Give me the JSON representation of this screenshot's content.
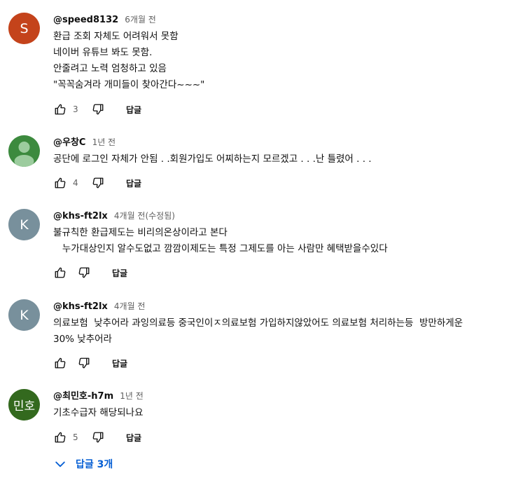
{
  "comments": [
    {
      "author": "@speed8132",
      "time": "6개월 전",
      "avatar_letter": "S",
      "avatar_color": "#c4431b",
      "lines": [
        "환급 조회 자체도 어려워서 못함",
        "네이버 유튜브 봐도 못함.",
        "안줄려고 노력 엄청하고 있음",
        "\"꼭꼭숨겨라 개미들이 찾아간다~~~\""
      ],
      "likes": "3",
      "reply_label": "답글"
    },
    {
      "author": "@우창C",
      "time": "1년 전",
      "avatar_letter": "",
      "avatar_color": "#3c8a3e",
      "lines": [
        "공단에 로그인 자체가 안됨 . .회원가입도 어찌하는지 모르겠고 . . .난 틀렸어 . . ."
      ],
      "likes": "4",
      "reply_label": "답글"
    },
    {
      "author": "@khs-ft2lx",
      "time": "4개월 전(수정됨)",
      "avatar_letter": "K",
      "avatar_color": "#78909c",
      "lines": [
        "불규칙한 환급제도는 비리의온상이라고 본다",
        "   누가대상인지 알수도없고 깜깜이제도는 특정 그제도를 아는 사람만 혜택받을수있다"
      ],
      "likes": "",
      "reply_label": "답글"
    },
    {
      "author": "@khs-ft2lx",
      "time": "4개월 전",
      "avatar_letter": "K",
      "avatar_color": "#78909c",
      "lines": [
        "의료보험  낮추어라 과잉의료등 중국인이ㅈ의료보험 가입하지않았어도 의료보험 처리하는등  방만하게운",
        "30% 낮추어라"
      ],
      "likes": "",
      "reply_label": "답글"
    },
    {
      "author": "@최민호-h7m",
      "time": "1년 전",
      "avatar_letter": "민호",
      "avatar_color": "#33691e",
      "lines": [
        "기초수급자 해당되나요"
      ],
      "likes": "5",
      "reply_label": "답글"
    }
  ],
  "view_replies_label": "답글 3개",
  "colors": {
    "link": "#065fd4",
    "secondary_text": "#606060"
  }
}
